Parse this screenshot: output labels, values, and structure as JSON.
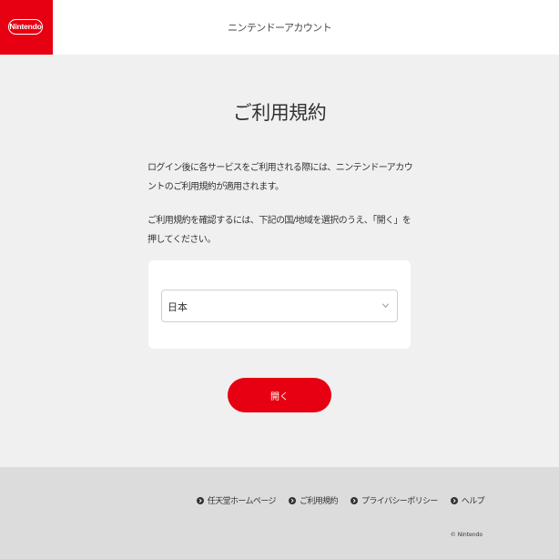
{
  "header": {
    "logo_text": "Nintendo",
    "title": "ニンテンドーアカウント"
  },
  "main": {
    "title": "ご利用規約",
    "description_1": "ログイン後に各サービスをご利用される際には、ニンテンドーアカウントのご利用規約が適用されます。",
    "description_2": "ご利用規約を確認するには、下記の国/地域を選択のうえ、「開く」を押してください。",
    "country_select": {
      "selected": "日本"
    },
    "open_button_label": "開く"
  },
  "footer": {
    "links": [
      {
        "label": "任天堂ホームページ"
      },
      {
        "label": "ご利用規約"
      },
      {
        "label": "プライバシーポリシー"
      },
      {
        "label": "ヘルプ"
      }
    ],
    "copyright": "© Nintendo"
  },
  "colors": {
    "brand_red": "#e60012",
    "background": "#f0f0f0",
    "footer_background": "#dcdcdc"
  },
  "icons": {
    "select_arrow": "chevron-down-icon",
    "footer_link": "circle-arrow-right-icon"
  }
}
